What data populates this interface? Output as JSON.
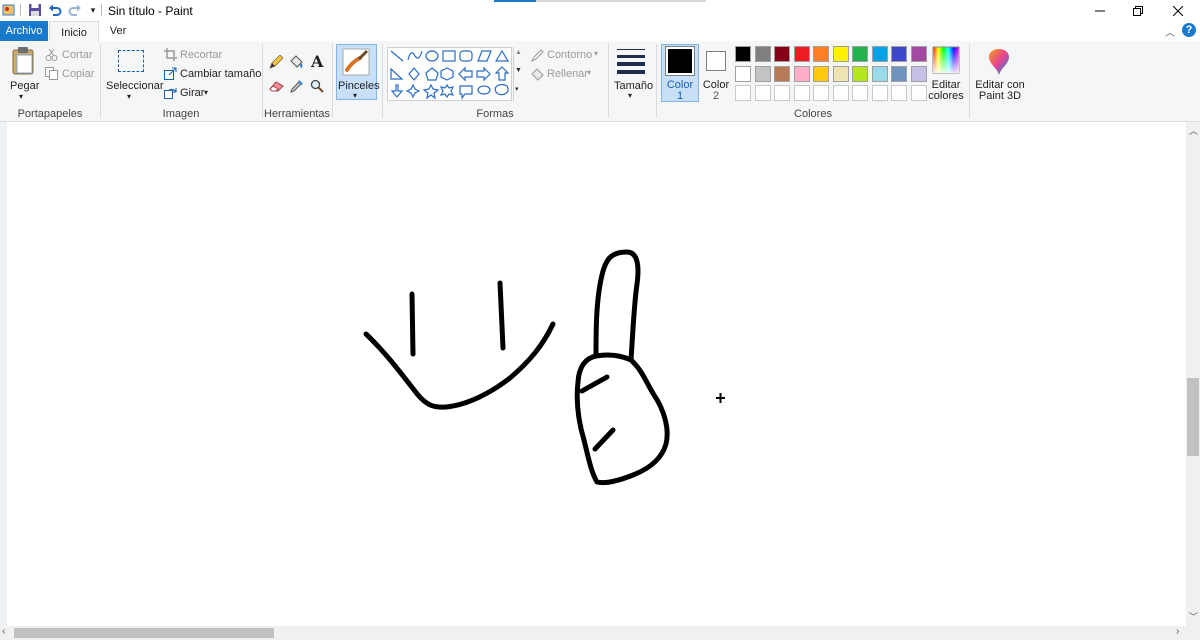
{
  "title": "Sin título - Paint",
  "tabs": {
    "file": "Archivo",
    "home": "Inicio",
    "view": "Ver"
  },
  "clipboard": {
    "paste": "Pegar",
    "cut": "Cortar",
    "copy": "Copiar",
    "group": "Portapapeles"
  },
  "image": {
    "select": "Seleccionar",
    "crop": "Recortar",
    "resize": "Cambiar tamaño",
    "rotate": "Girar",
    "group": "Imagen"
  },
  "tools": {
    "group": "Herramientas"
  },
  "brushes": {
    "label": "Pinceles"
  },
  "shapes": {
    "outline": "Contorno",
    "fill": "Rellenar",
    "group": "Formas"
  },
  "size": {
    "label": "Tamaño"
  },
  "colors": {
    "color1": "Color",
    "color1_num": "1",
    "color2": "Color",
    "color2_num": "2",
    "edit": "Editar",
    "edit2": "colores",
    "paint3d": "Editar con",
    "paint3d2": "Paint 3D",
    "group": "Colores",
    "color1_value": "#000000",
    "color2_value": "#ffffff",
    "palette_row1": [
      "#000000",
      "#7f7f7f",
      "#880015",
      "#ed1c24",
      "#ff7f27",
      "#fff200",
      "#22b14c",
      "#00a2e8",
      "#3f48cc",
      "#a349a4"
    ],
    "palette_row2": [
      "#ffffff",
      "#c3c3c3",
      "#b97a57",
      "#ffaec9",
      "#ffc90e",
      "#efe4b0",
      "#b5e61d",
      "#99d9ea",
      "#7092be",
      "#c8bfe7"
    ],
    "palette_row3": [
      "#ffffff",
      "#ffffff",
      "#ffffff",
      "#ffffff",
      "#ffffff",
      "#ffffff",
      "#ffffff",
      "#ffffff",
      "#ffffff",
      "#ffffff"
    ]
  },
  "icons": [
    "save-icon",
    "undo-icon",
    "redo-icon",
    "pencil-icon",
    "fill-bucket-icon",
    "text-icon",
    "eraser-icon",
    "color-picker-icon",
    "magnifier-icon",
    "brush-icon",
    "help-icon"
  ]
}
